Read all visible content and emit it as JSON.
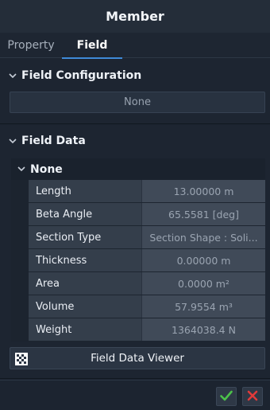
{
  "window": {
    "title": "Member"
  },
  "tabs": [
    {
      "label": "Property",
      "active": false
    },
    {
      "label": "Field",
      "active": true
    }
  ],
  "field_configuration": {
    "title": "Field Configuration",
    "value": "None"
  },
  "field_data": {
    "title": "Field Data",
    "group": {
      "title": "None",
      "rows": [
        {
          "label": "Length",
          "value": "13.00000 m"
        },
        {
          "label": "Beta Angle",
          "value": "65.5581 [deg]"
        },
        {
          "label": "Section Type",
          "value": "Section Shape : Soli..."
        },
        {
          "label": "Thickness",
          "value": "0.00000 m"
        },
        {
          "label": "Area",
          "value": "0.0000 m²"
        },
        {
          "label": "Volume",
          "value": "57.9554 m³"
        },
        {
          "label": "Weight",
          "value": "1364038.4 N"
        }
      ]
    }
  },
  "viewer_button": {
    "label": "Field Data Viewer",
    "icon": "checker-pattern-icon"
  },
  "footer": {
    "ok_icon": "checkmark-icon",
    "cancel_icon": "close-icon"
  },
  "colors": {
    "accent": "#3f8ad8",
    "ok": "#4cc24a",
    "cancel": "#e03a3a"
  }
}
